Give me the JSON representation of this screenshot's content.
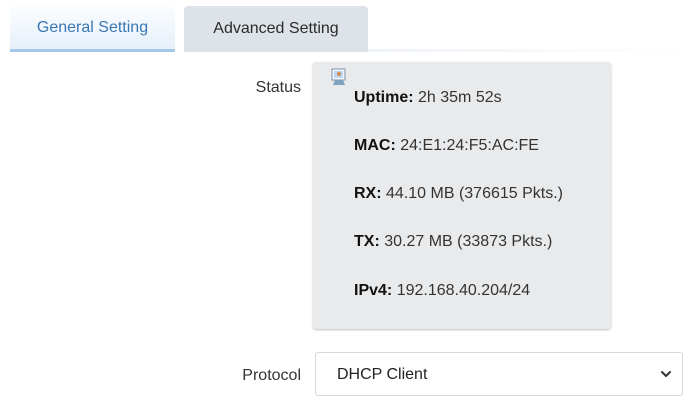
{
  "tabs": {
    "general": "General Setting",
    "advanced": "Advanced Setting"
  },
  "status": {
    "label": "Status",
    "icon": "network-status-icon",
    "uptime_label": "Uptime:",
    "uptime_value": "2h 35m 52s",
    "mac_label": "MAC:",
    "mac_value": "24:E1:24:F5:AC:FE",
    "rx_label": "RX:",
    "rx_value": "44.10 MB (376615 Pkts.)",
    "tx_label": "TX:",
    "tx_value": "30.27 MB (33873 Pkts.)",
    "ipv4_label": "IPv4:",
    "ipv4_value": "192.168.40.204/24"
  },
  "protocol": {
    "label": "Protocol",
    "selected": "DHCP Client",
    "icon": "chevron-down-icon"
  },
  "colors": {
    "active_tab_text": "#3b77b3",
    "active_tab_border": "#a6c8e8",
    "inactive_tab_bg": "#dde3e8",
    "status_panel_bg": "#e8eaec"
  }
}
